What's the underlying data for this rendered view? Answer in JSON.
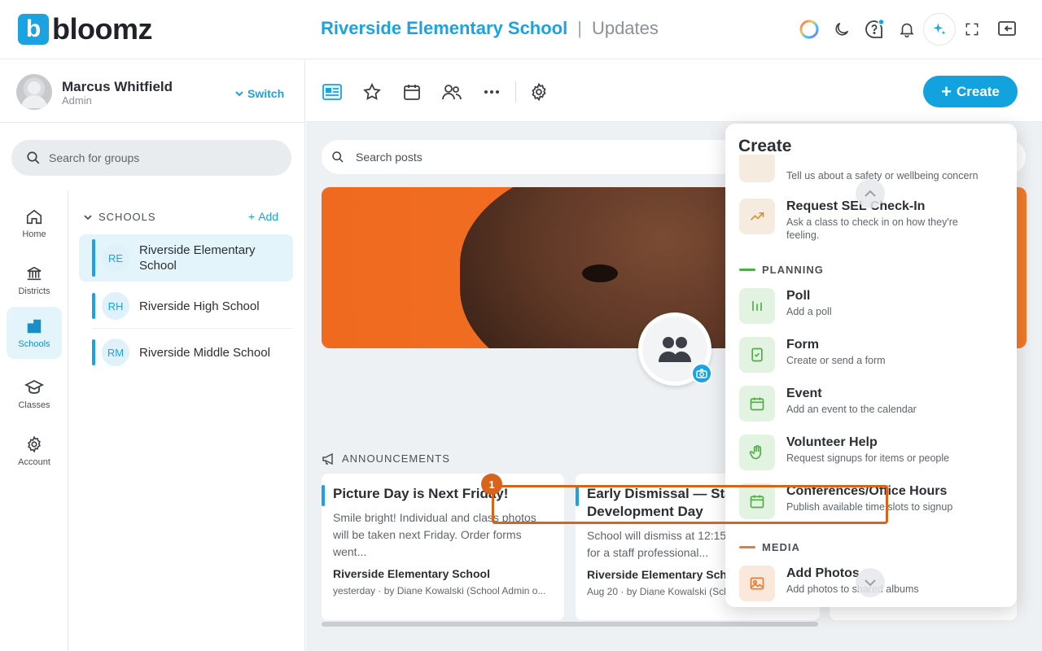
{
  "app": {
    "logo_letter": "b",
    "logo_text": "bloomz",
    "accent": "#1aa3e0"
  },
  "header": {
    "school": "Riverside Elementary School",
    "separator": "|",
    "page": "Updates"
  },
  "user": {
    "name": "Marcus Whitfield",
    "role": "Admin",
    "switch_label": "Switch"
  },
  "group_search": {
    "placeholder": "Search for groups"
  },
  "rail": [
    {
      "label": "Home"
    },
    {
      "label": "Districts"
    },
    {
      "label": "Schools"
    },
    {
      "label": "Classes"
    },
    {
      "label": "Account"
    }
  ],
  "schools": {
    "heading": "SCHOOLS",
    "add_label": "Add",
    "items": [
      {
        "initials": "RE",
        "name": "Riverside Elementary School"
      },
      {
        "initials": "RH",
        "name": "Riverside High School"
      },
      {
        "initials": "RM",
        "name": "Riverside Middle School"
      }
    ]
  },
  "toolbar": {
    "create_label": "Create"
  },
  "post_search": {
    "placeholder": "Search posts"
  },
  "announcements": {
    "heading": "ANNOUNCEMENTS",
    "cards": [
      {
        "title": "Picture Day is Next Friday!",
        "body": "Smile bright! Individual and class photos will be taken next Friday. Order forms went...",
        "school": "Riverside Elementary School",
        "meta": "yesterday · by Diane Kowalski (School Admin o..."
      },
      {
        "title": "Early Dismissal — Staff Development Day",
        "body": "School will dismiss at 12:15 on Wednesday for a staff professional...",
        "school": "Riverside Elementary School",
        "meta": "Aug 20 · by Diane Kowalski (School Admin o..."
      }
    ]
  },
  "create_menu": {
    "title": "Create",
    "partial_top_desc": "Tell us about a safety or wellbeing concern",
    "sel_item": {
      "label": "Request SEL Check-In",
      "desc": "Ask a class to check in on how they're feeling."
    },
    "planning_heading": "PLANNING",
    "planning_items": [
      {
        "label": "Poll",
        "desc": "Add a poll",
        "icon": "poll-icon"
      },
      {
        "label": "Form",
        "desc": "Create or send a form",
        "icon": "form-icon"
      },
      {
        "label": "Event",
        "desc": "Add an event to the calendar",
        "icon": "calendar-icon"
      },
      {
        "label": "Volunteer Help",
        "desc": "Request signups for items or people",
        "icon": "hand-icon"
      },
      {
        "label": "Conferences/Office Hours",
        "desc": "Publish available time slots to signup",
        "icon": "calendar-icon"
      }
    ],
    "media_heading": "MEDIA",
    "media_items": [
      {
        "label": "Add Photos",
        "desc": "Add photos to shared albums",
        "icon": "photo-icon"
      }
    ]
  },
  "annotation": {
    "badge": "1",
    "color": "#d8631b"
  }
}
